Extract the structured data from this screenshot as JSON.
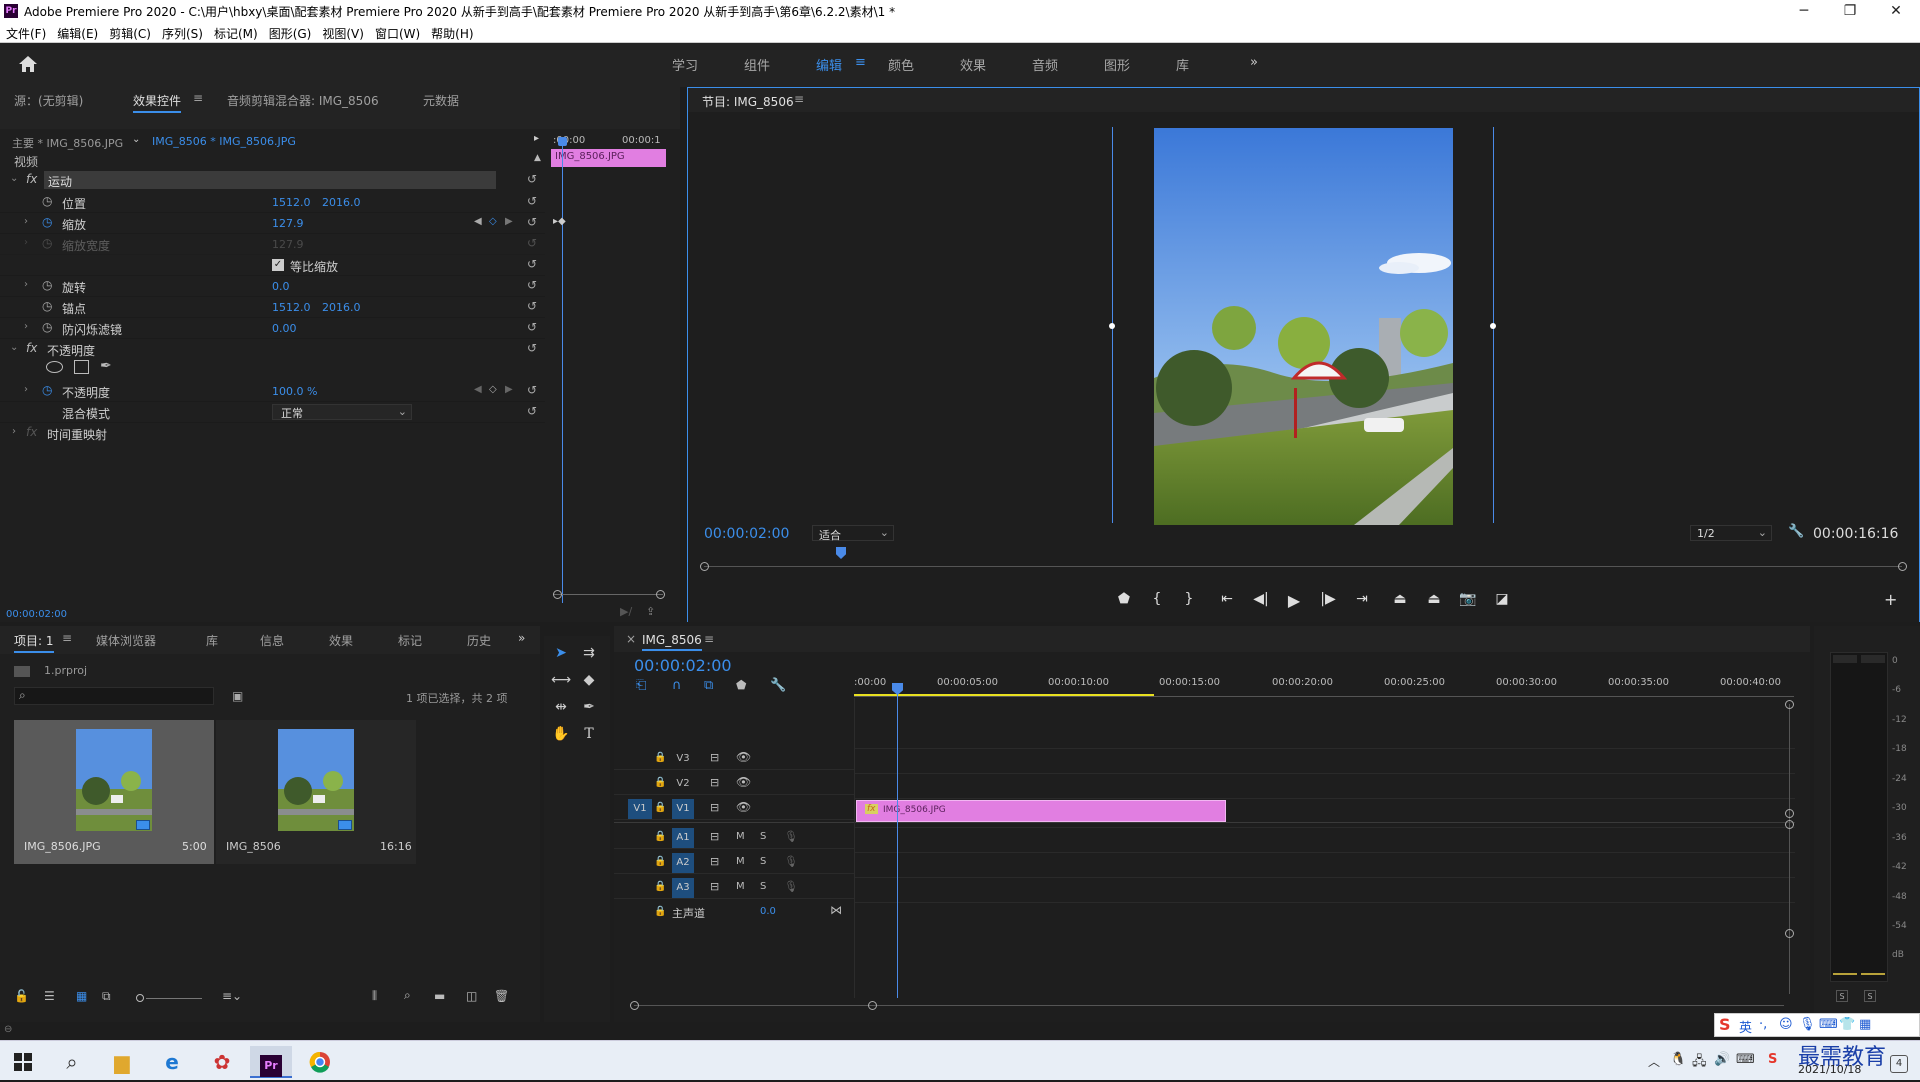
{
  "titlebar": {
    "logo": "Pr",
    "title": "Adobe Premiere Pro 2020 - C:\\用户\\hbxy\\桌面\\配套素材 Premiere Pro 2020 从新手到高手\\配套素材 Premiere Pro 2020 从新手到高手\\第6章\\6.2.2\\素材\\1 *",
    "minimize": "─",
    "restore": "❐",
    "close": "✕"
  },
  "menu": [
    "文件(F)",
    "编辑(E)",
    "剪辑(C)",
    "序列(S)",
    "标记(M)",
    "图形(G)",
    "视图(V)",
    "窗口(W)",
    "帮助(H)"
  ],
  "workspaces": {
    "items": [
      "学习",
      "组件",
      "编辑",
      "颜色",
      "效果",
      "音频",
      "图形",
      "库"
    ],
    "active": "编辑",
    "menu_icon": "≡",
    "more": "»"
  },
  "effects_panel": {
    "tabs": [
      "源：(无剪辑)",
      "效果控件",
      "音频剪辑混合器: IMG_8506",
      "元数据"
    ],
    "active_tab": "效果控件",
    "master_label": "主要 * IMG_8506.JPG",
    "clip_label": "IMG_8506 * IMG_8506.JPG",
    "mini_time_start": ":00:00",
    "mini_time_end": "00:00:1",
    "mini_clip_name": "IMG_8506.JPG",
    "section_video": "视频",
    "motion_label": "运动",
    "opacity_group": "不透明度",
    "time_remap": "时间重映射",
    "fx": "fx",
    "props": {
      "position": {
        "label": "位置",
        "x": "1512.0",
        "y": "2016.0"
      },
      "scale": {
        "label": "缩放",
        "value": "127.9"
      },
      "scale_width": {
        "label": "缩放宽度",
        "value": "127.9"
      },
      "uniform_scale": {
        "label": "等比缩放",
        "checked": true
      },
      "rotation": {
        "label": "旋转",
        "value": "0.0"
      },
      "anchor": {
        "label": "锚点",
        "x": "1512.0",
        "y": "2016.0"
      },
      "antiflicker": {
        "label": "防闪烁滤镜",
        "value": "0.00"
      },
      "opacity": {
        "label": "不透明度",
        "value": "100.0 %"
      },
      "blend": {
        "label": "混合模式",
        "value": "正常"
      }
    },
    "timecode": "00:00:02:00"
  },
  "program_monitor": {
    "title": "节目: IMG_8506",
    "timecode": "00:00:02:00",
    "zoom": "适合",
    "resolution": "1/2",
    "duration": "00:00:16:16",
    "add": "+"
  },
  "project_panel": {
    "tabs": [
      "项目: 1",
      "媒体浏览器",
      "库",
      "信息",
      "效果",
      "标记",
      "历史"
    ],
    "active_tab": "项目: 1",
    "more": "»",
    "proj_file": "1.prproj",
    "search_placeholder": "",
    "selection_info": "1 项已选择，共 2 项",
    "items": [
      {
        "name": "IMG_8506.JPG",
        "duration": "5:00"
      },
      {
        "name": "IMG_8506",
        "duration": "16:16"
      }
    ]
  },
  "timeline": {
    "sequence_name": "IMG_8506",
    "close": "×",
    "timecode": "00:00:02:00",
    "ruler": [
      ":00:00",
      "00:00:05:00",
      "00:00:10:00",
      "00:00:15:00",
      "00:00:20:00",
      "00:00:25:00",
      "00:00:30:00",
      "00:00:35:00",
      "00:00:40:00"
    ],
    "tracks": {
      "v3": "V3",
      "v2": "V2",
      "v1": "V1",
      "v1_source": "V1",
      "a1": "A1",
      "a2": "A2",
      "a3": "A3",
      "m": "M",
      "s": "S",
      "master": "主声道",
      "master_value": "0.0"
    },
    "clip_name": "IMG_8506.JPG",
    "clip_fx": "fx"
  },
  "meter": {
    "scale": [
      "0",
      "-6",
      "-12",
      "-18",
      "-24",
      "-30",
      "-36",
      "-42",
      "-48",
      "-54",
      "dB"
    ],
    "solo": [
      "S",
      "S"
    ]
  },
  "taskbar": {
    "ime": "英",
    "watermark": "最需教育",
    "date": "2021/10/18",
    "notif_count": "4"
  },
  "colors": {
    "accent": "#3b8eea",
    "clip": "#e17ee1",
    "playhead": "#4a8ae8",
    "workarea": "#e8e020"
  }
}
